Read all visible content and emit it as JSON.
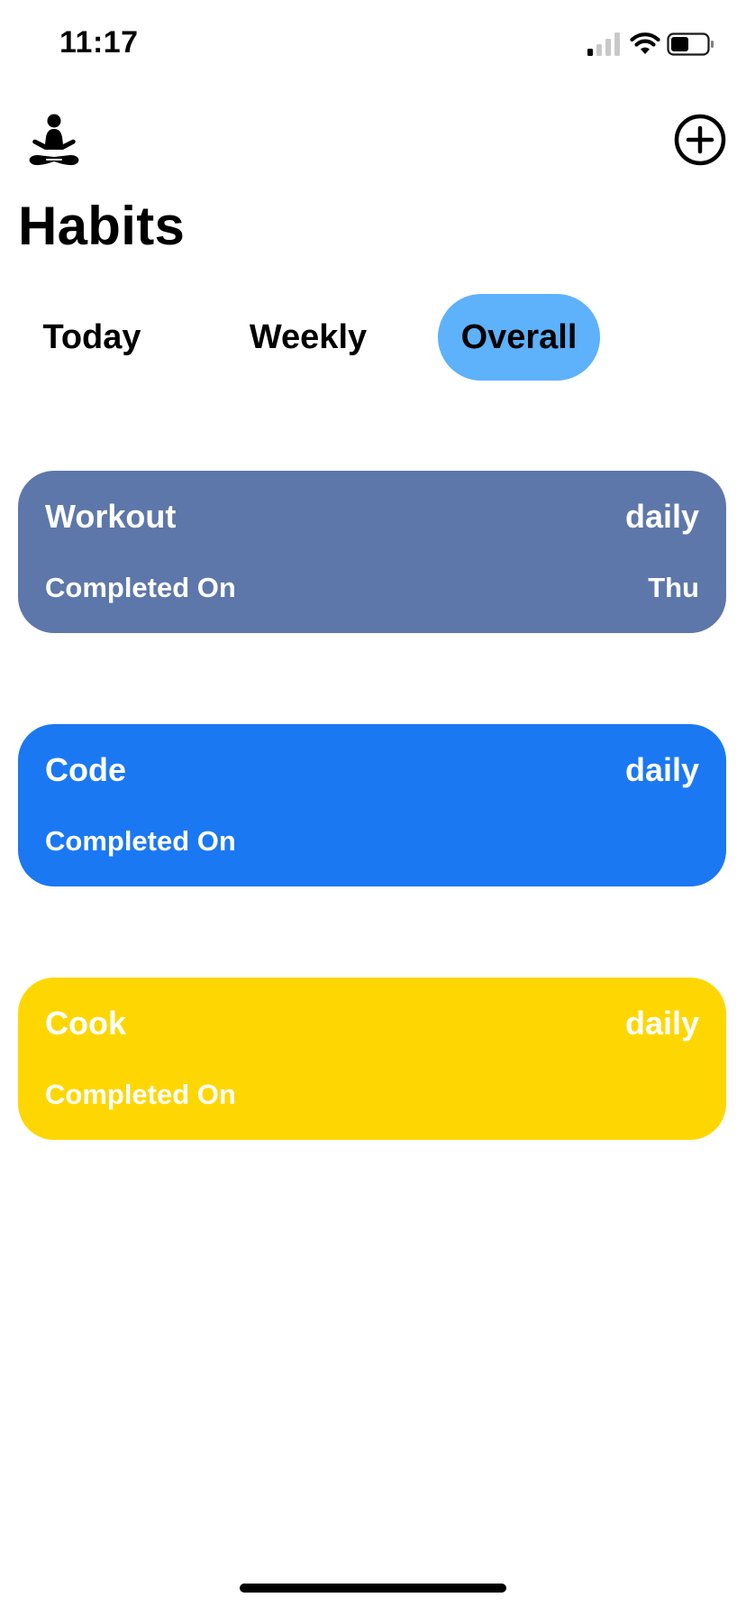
{
  "status_bar": {
    "time": "11:17"
  },
  "header": {
    "logo_icon": "meditation-figure-icon",
    "add_icon": "plus-circle-icon",
    "title": "Habits"
  },
  "tabs": [
    {
      "label": "Today",
      "active": false
    },
    {
      "label": "Weekly",
      "active": false
    },
    {
      "label": "Overall",
      "active": true
    }
  ],
  "colors": {
    "active_tab": "#5eb1fb",
    "card_workout": "#5d77aa",
    "card_code": "#1b78f3",
    "card_cook": "#fed703"
  },
  "habits": [
    {
      "name": "Workout",
      "frequency": "daily",
      "completed_label": "Completed On",
      "completed_value": "Thu",
      "color": "#5d77aa"
    },
    {
      "name": "Code",
      "frequency": "daily",
      "completed_label": "Completed On",
      "completed_value": "",
      "color": "#1b78f3"
    },
    {
      "name": "Cook",
      "frequency": "daily",
      "completed_label": "Completed On",
      "completed_value": "",
      "color": "#fed703"
    }
  ]
}
